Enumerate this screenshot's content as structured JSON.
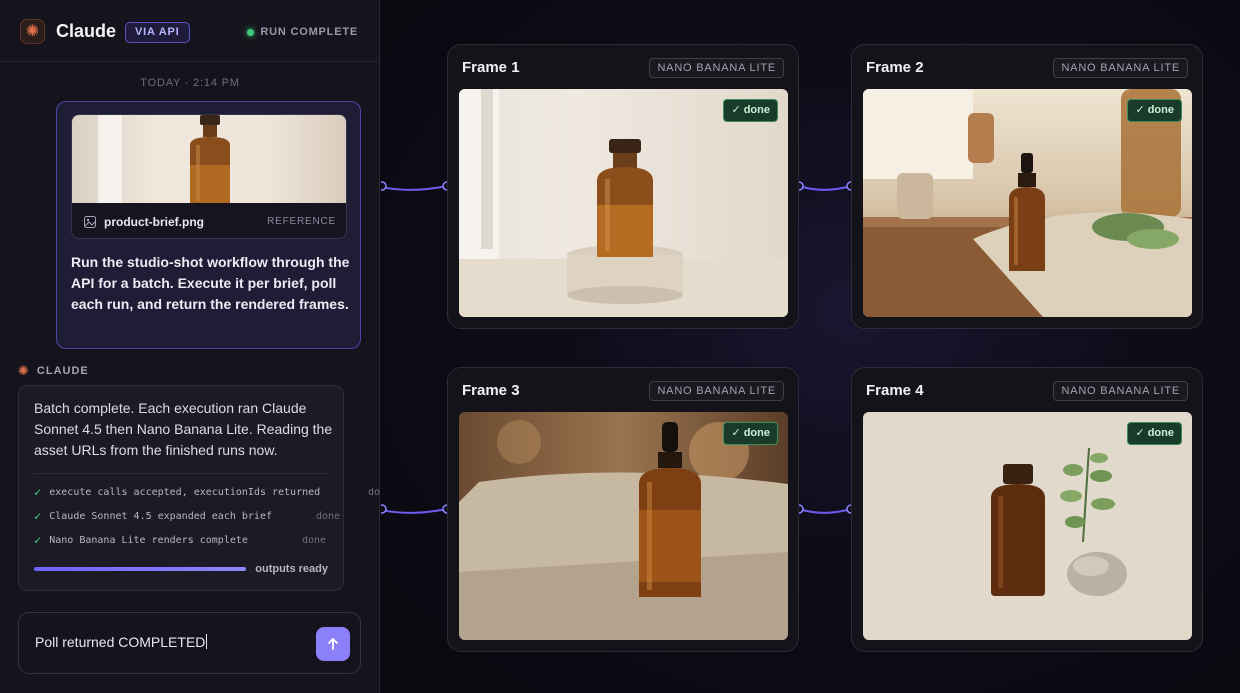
{
  "header": {
    "app_title": "Claude",
    "api_badge": "VIA API",
    "run_status": "RUN COMPLETE"
  },
  "chat": {
    "timestamp": "TODAY · 2:14 PM",
    "user_message": {
      "attachment_name": "product-brief.png",
      "attachment_tag": "REFERENCE",
      "text": "Run the studio-shot workflow through the API for a batch. Execute it per brief, poll each run, and return the rendered frames."
    },
    "assistant_label": "CLAUDE",
    "assistant_message": {
      "text": "Batch complete. Each execution ran Claude Sonnet 4.5 then Nano Banana Lite. Reading the asset URLs from the finished runs now.",
      "steps": [
        {
          "label": "execute calls accepted, executionIds returned",
          "state": "done"
        },
        {
          "label": "Claude Sonnet 4.5 expanded each brief",
          "state": "done"
        },
        {
          "label": "Nano Banana Lite renders complete",
          "state": "done"
        }
      ],
      "progress": 1.0,
      "progress_label": "outputs ready"
    },
    "composer": {
      "value": "Poll returned COMPLETED"
    }
  },
  "frames": [
    {
      "title": "Frame 1",
      "model": "NANO BANANA LITE",
      "status": "✓ done"
    },
    {
      "title": "Frame 2",
      "model": "NANO BANANA LITE",
      "status": "✓ done"
    },
    {
      "title": "Frame 3",
      "model": "NANO BANANA LITE",
      "status": "✓ done"
    },
    {
      "title": "Frame 4",
      "model": "NANO BANANA LITE",
      "status": "✓ done"
    }
  ],
  "colors": {
    "accent": "#8b80f9",
    "success": "#3ec97a",
    "brand": "#e0704a"
  }
}
